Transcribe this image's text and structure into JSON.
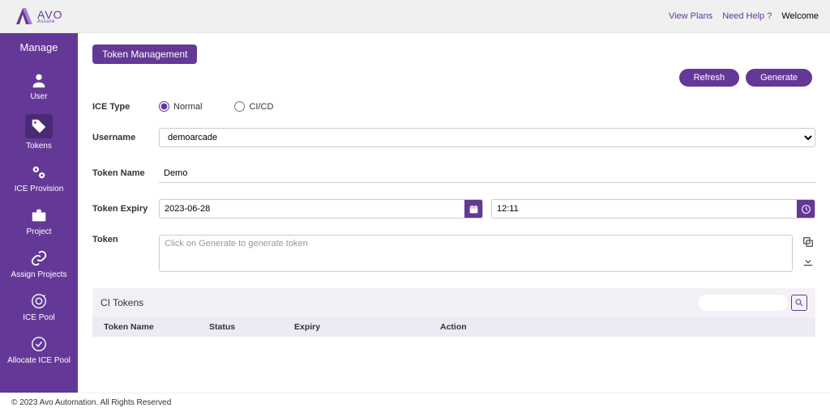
{
  "header": {
    "brand": "AVO",
    "brand_sub": "Assure",
    "links": {
      "plans": "View Plans",
      "help": "Need Help ?",
      "welcome": "Welcome"
    }
  },
  "sidebar": {
    "title": "Manage",
    "items": [
      {
        "label": "User"
      },
      {
        "label": "Tokens"
      },
      {
        "label": "ICE Provision"
      },
      {
        "label": "Project"
      },
      {
        "label": "Assign Projects"
      },
      {
        "label": "ICE Pool"
      },
      {
        "label": "Allocate ICE Pool"
      }
    ]
  },
  "page": {
    "title": "Token Management",
    "refresh": "Refresh",
    "generate": "Generate"
  },
  "form": {
    "ice_type_label": "ICE Type",
    "radio_normal": "Normal",
    "radio_cicd": "CI/CD",
    "username_label": "Username",
    "username_value": "demoarcade",
    "tokenname_label": "Token Name",
    "tokenname_value": "Demo",
    "expiry_label": "Token Expiry",
    "expiry_date": "2023-06-28",
    "expiry_time": "12:11",
    "token_label": "Token",
    "token_placeholder": "Click on Generate to generate token"
  },
  "ci": {
    "title": "CI Tokens",
    "cols": {
      "name": "Token Name",
      "status": "Status",
      "expiry": "Expiry",
      "action": "Action"
    }
  },
  "footer": "© 2023 Avo Automation. All Rights Reserved"
}
